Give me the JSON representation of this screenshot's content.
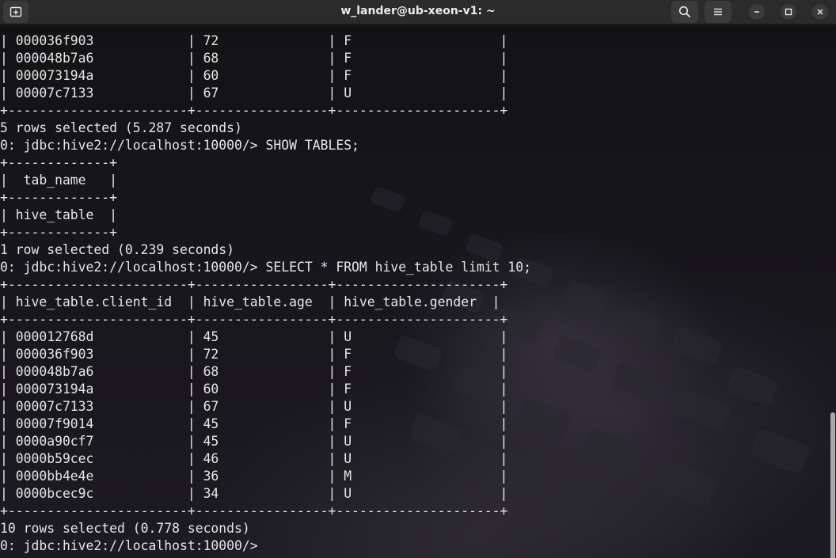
{
  "window": {
    "title": "w_lander@ub-xeon-v1: ~"
  },
  "terminal": {
    "lines": [
      "| 000036f903            | 72              | F                   |",
      "| 000048b7a6            | 68              | F                   |",
      "| 000073194a            | 60              | F                   |",
      "| 00007c7133            | 67              | U                   |",
      "+-----------------------+-----------------+---------------------+",
      "5 rows selected (5.287 seconds)",
      "0: jdbc:hive2://localhost:10000/> SHOW TABLES;",
      "+-------------+",
      "|  tab_name   |",
      "+-------------+",
      "| hive_table  |",
      "+-------------+",
      "1 row selected (0.239 seconds)",
      "0: jdbc:hive2://localhost:10000/> SELECT * FROM hive_table limit 10;",
      "+-----------------------+-----------------+---------------------+",
      "| hive_table.client_id  | hive_table.age  | hive_table.gender  |",
      "+-----------------------+-----------------+---------------------+",
      "| 000012768d            | 45              | U                   |",
      "| 000036f903            | 72              | F                   |",
      "| 000048b7a6            | 68              | F                   |",
      "| 000073194a            | 60              | F                   |",
      "| 00007c7133            | 67              | U                   |",
      "| 00007f9014            | 45              | F                   |",
      "| 0000a90cf7            | 45              | U                   |",
      "| 0000b59cec            | 46              | U                   |",
      "| 0000bb4e4e            | 36              | M                   |",
      "| 0000bcec9c            | 34              | U                   |",
      "+-----------------------+-----------------+---------------------+",
      "10 rows selected (0.778 seconds)",
      "0: jdbc:hive2://localhost:10000/> "
    ]
  }
}
